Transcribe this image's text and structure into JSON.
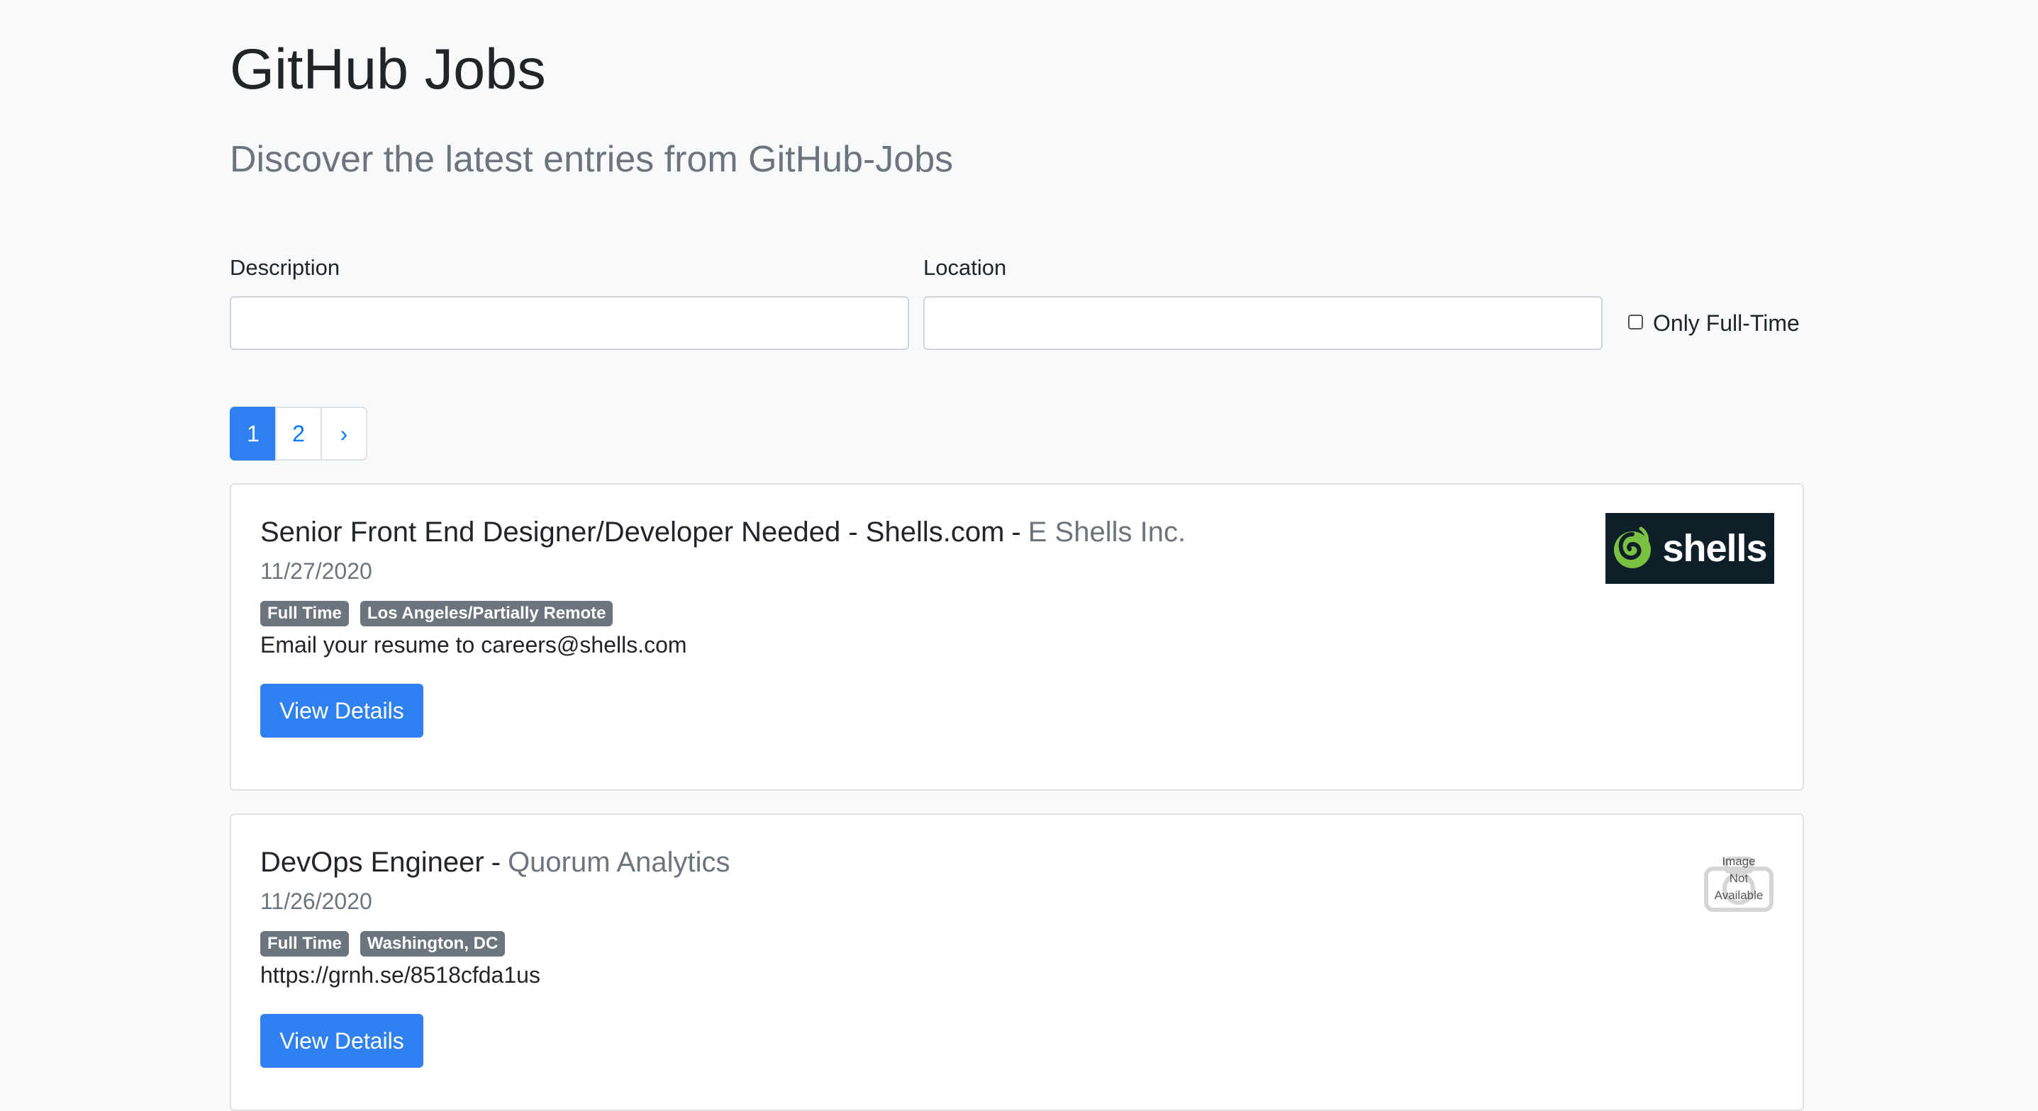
{
  "header": {
    "title": "GitHub Jobs",
    "subtitle": "Discover the latest entries from GitHub-Jobs"
  },
  "search": {
    "description_label": "Description",
    "description_value": "",
    "location_label": "Location",
    "location_value": "",
    "fulltime_label": "Only Full-Time",
    "fulltime_checked": false
  },
  "pagination": {
    "pages": [
      "1",
      "2"
    ],
    "active": "1",
    "next_label": "›"
  },
  "jobs": [
    {
      "title": "Senior Front End Designer/Developer Needed - Shells.com",
      "separator": "-",
      "company": "E Shells Inc.",
      "date": "11/27/2020",
      "type": "Full Time",
      "location": "Los Angeles/Partially Remote",
      "how_to_apply": "Email your resume to careers@shells.com",
      "button_label": "View Details",
      "logo_text": "shells",
      "logo_icon": "shells-swirl-logo-icon"
    },
    {
      "title": "DevOps Engineer",
      "separator": "-",
      "company": "Quorum Analytics",
      "date": "11/26/2020",
      "type": "Full Time",
      "location": "Washington, DC",
      "how_to_apply": "https://grnh.se/8518cfda1us",
      "button_label": "View Details",
      "logo_placeholder": [
        "Image",
        "Not",
        "Available"
      ],
      "logo_icon": "camera-placeholder-icon"
    }
  ],
  "colors": {
    "primary": "#2f80f0",
    "badge": "#6c757d",
    "muted_text": "#6c757d",
    "page_bg": "#f8f9fa",
    "logo_bg": "#0f1f2a",
    "logo_green": "#7ac142"
  }
}
